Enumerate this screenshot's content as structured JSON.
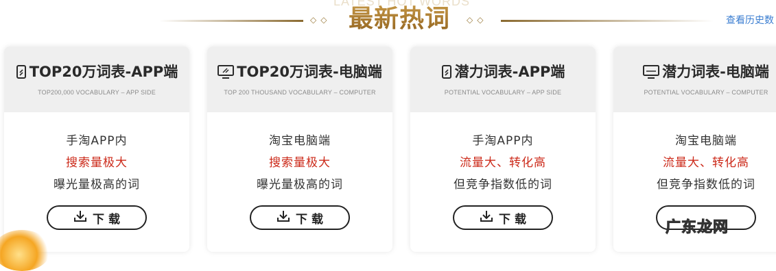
{
  "header": {
    "bg_title": "LATEST HOT WORDS",
    "title": "最新热词",
    "diamonds_left": "◇◇",
    "diamonds_right": "◇◇",
    "history_link": "查看历史数"
  },
  "cards": [
    {
      "title": "TOP20万词表-APP端",
      "subtitle": "TOP200,000 VOCABULARY – APP SIDE",
      "icon": "phone-icon",
      "lines": [
        "手淘APP内",
        "搜索量极大",
        "曝光量极高的词"
      ],
      "button": "下 载"
    },
    {
      "title": "TOP20万词表-电脑端",
      "subtitle": "TOP 200 THOUSAND VOCABULARY – COMPUTER",
      "icon": "monitor-icon",
      "lines": [
        "淘宝电脑端",
        "搜索量极大",
        "曝光量极高的词"
      ],
      "button": "下 载"
    },
    {
      "title": "潜力词表-APP端",
      "subtitle": "POTENTIAL VOCABULARY – APP SIDE",
      "icon": "phone-icon",
      "lines": [
        "手淘APP内",
        "流量大、转化高",
        "但竞争指数低的词"
      ],
      "button": "下 载"
    },
    {
      "title": "潜力词表-电脑端",
      "subtitle": "POTENTIAL VOCABULARY – COMPUTER",
      "icon": "monitor-icon",
      "lines": [
        "淘宝电脑端",
        "流量大、转化高",
        "但竞争指数低的词"
      ],
      "button": ""
    }
  ],
  "watermark": "广东龙网",
  "colors": {
    "accent_gold": "#a8762c",
    "highlight_red": "#cc2a1a",
    "link_blue": "#3b7ed1"
  }
}
